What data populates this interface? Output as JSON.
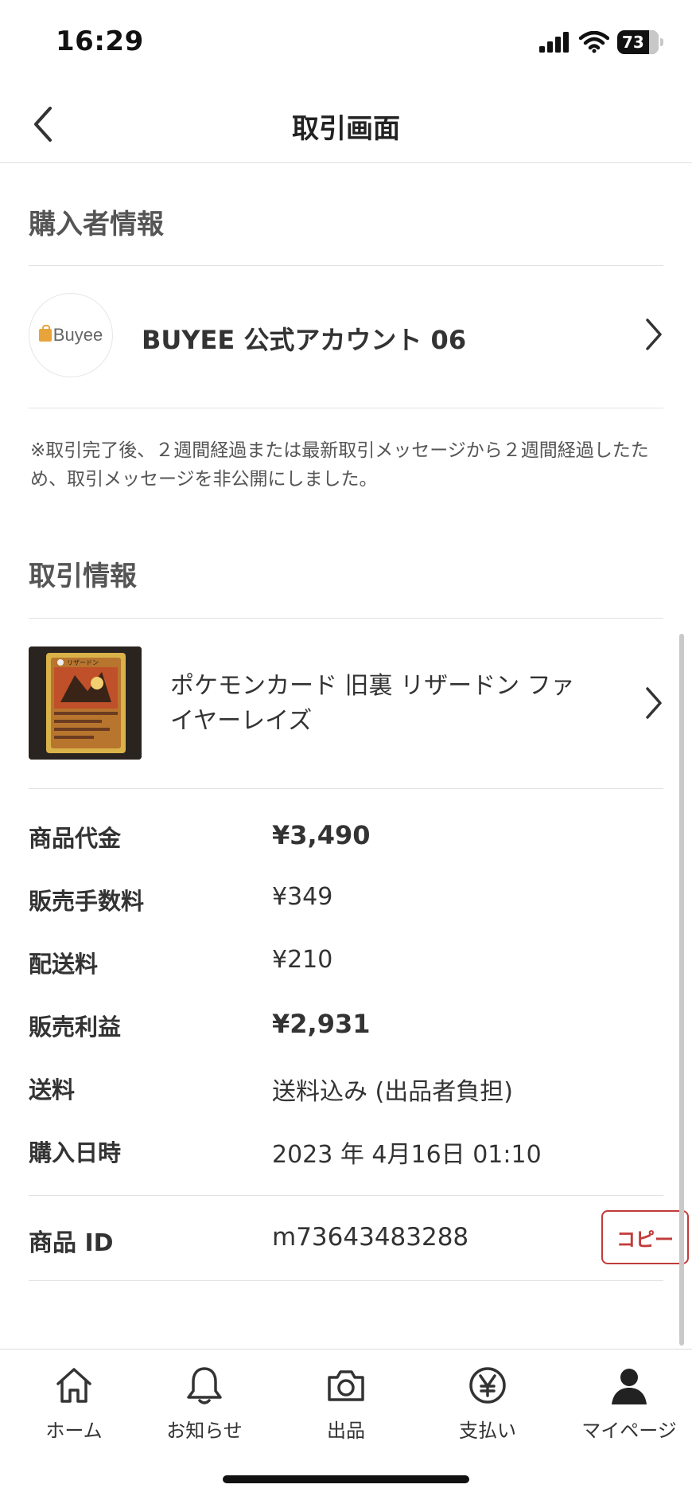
{
  "status_bar": {
    "time": "16:29",
    "battery": "73"
  },
  "nav": {
    "title": "取引画面"
  },
  "buyer_section": {
    "title": "購入者情報",
    "logo_text": "Buyee",
    "user_name": "BUYEE 公式アカウント 06",
    "notice": "※取引完了後、２週間経過または最新取引メッセージから２週間経過したため、取引メッセージを非公開にしました。"
  },
  "transaction_section": {
    "title": "取引情報",
    "item": {
      "title": "ポケモンカード 旧裏 リザードン ファイヤーレイズ",
      "card_name": "リザードン"
    },
    "rows": [
      {
        "label": "商品代金",
        "value": "¥3,490",
        "bold": true
      },
      {
        "label": "販売手数料",
        "value": "¥349",
        "bold": false
      },
      {
        "label": "配送料",
        "value": "¥210",
        "bold": false
      },
      {
        "label": "販売利益",
        "value": "¥2,931",
        "bold": true
      },
      {
        "label": "送料",
        "value": "送料込み (出品者負担)",
        "bold": false
      },
      {
        "label": "購入日時",
        "value": "2023 年 4月16日 01:10",
        "bold": false
      }
    ],
    "product_id": {
      "label": "商品 ID",
      "value": "m73643483288",
      "copy_label": "コピー"
    }
  },
  "tab_bar": {
    "items": [
      {
        "label": "ホーム",
        "icon": "home-icon"
      },
      {
        "label": "お知らせ",
        "icon": "bell-icon"
      },
      {
        "label": "出品",
        "icon": "camera-icon"
      },
      {
        "label": "支払い",
        "icon": "yen-icon"
      },
      {
        "label": "マイページ",
        "icon": "person-icon"
      }
    ]
  },
  "colors": {
    "accent_red": "#c23b3b",
    "text_primary": "#333333",
    "section_gray": "#555555"
  }
}
